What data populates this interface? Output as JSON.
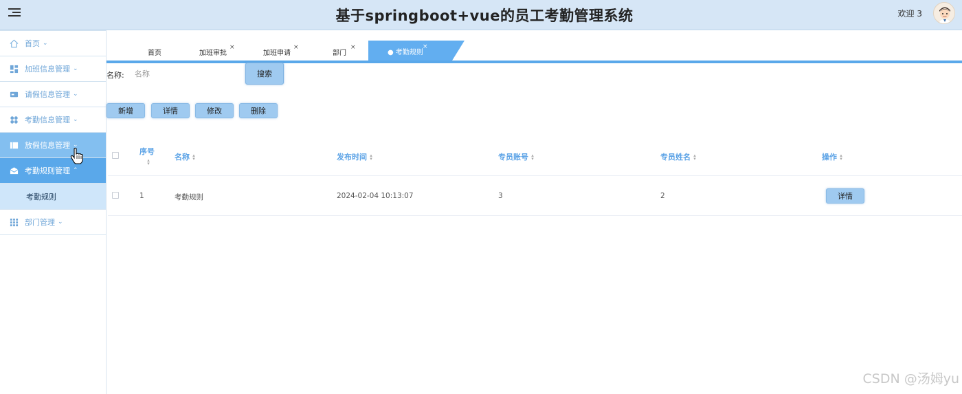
{
  "header": {
    "title": "基于springboot+vue的员工考勤管理系统",
    "welcome": "欢迎 3"
  },
  "sidebar": {
    "items": [
      {
        "label": "首页",
        "icon": "home-icon"
      },
      {
        "label": "加班信息管理",
        "icon": "dashboard-icon"
      },
      {
        "label": "请假信息管理",
        "icon": "card-icon"
      },
      {
        "label": "考勤信息管理",
        "icon": "grid-circles-icon"
      },
      {
        "label": "放假信息管理",
        "icon": "book-icon"
      },
      {
        "label": "考勤规则管理",
        "icon": "envelope-icon"
      },
      {
        "label": "部门管理",
        "icon": "apps-icon"
      }
    ],
    "subitem": "考勤规则"
  },
  "tabs": [
    {
      "label": "首页"
    },
    {
      "label": "加班审批",
      "close": "×"
    },
    {
      "label": "加班申请",
      "close": "×"
    },
    {
      "label": "部门",
      "close": "×"
    },
    {
      "label": "● 考勤规则",
      "close": "×",
      "active": true
    }
  ],
  "search": {
    "label": "名称:",
    "placeholder": "名称",
    "button": "搜索"
  },
  "actions": {
    "add": "新增",
    "detail": "详情",
    "edit": "修改",
    "delete": "删除"
  },
  "table": {
    "columns": [
      "序号",
      "名称",
      "发布时间",
      "专员账号",
      "专员姓名",
      "操作"
    ],
    "rows": [
      {
        "index": "1",
        "name": "考勤规则",
        "time": "2024-02-04 10:13:07",
        "account": "3",
        "username": "2",
        "op": "详情"
      }
    ]
  },
  "watermark": "CSDN @汤姆yu",
  "colors": {
    "accent": "#5aa8ea",
    "header_bg": "#d6e6f6",
    "button_bg": "#9fcaf0",
    "sidebar_text": "#6fa6d8"
  }
}
